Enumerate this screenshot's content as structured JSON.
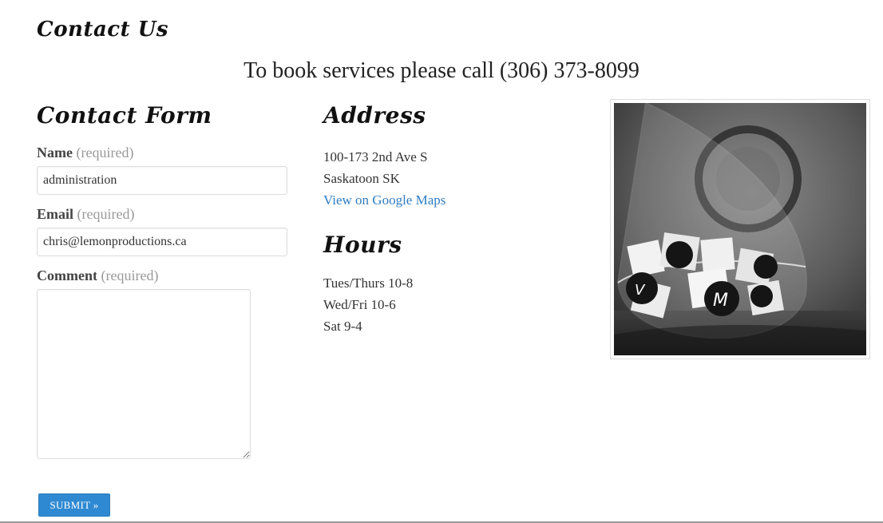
{
  "page": {
    "title": "Contact Us",
    "booking_line": "To book services please call (306) 373-8099"
  },
  "form": {
    "title": "Contact Form",
    "name_label": "Name",
    "name_required": "(required)",
    "name_value": "administration",
    "email_label": "Email",
    "email_required": "(required)",
    "email_value": "chris@lemonproductions.ca",
    "comment_label": "Comment",
    "comment_required": "(required)",
    "comment_value": "",
    "submit_label": "SUBMIT »"
  },
  "address": {
    "title": "Address",
    "line1": "100-173 2nd Ave S",
    "line2": "Saskatoon SK",
    "map_link": "View on Google Maps"
  },
  "hours": {
    "title": "Hours",
    "line1": "Tues/Thurs 10-8",
    "line2": "Wed/Fri 10-6",
    "line3": "Sat 9-4"
  },
  "colors": {
    "accent": "#2f89d2",
    "link": "#2f7cc0",
    "required_text": "#999999"
  }
}
